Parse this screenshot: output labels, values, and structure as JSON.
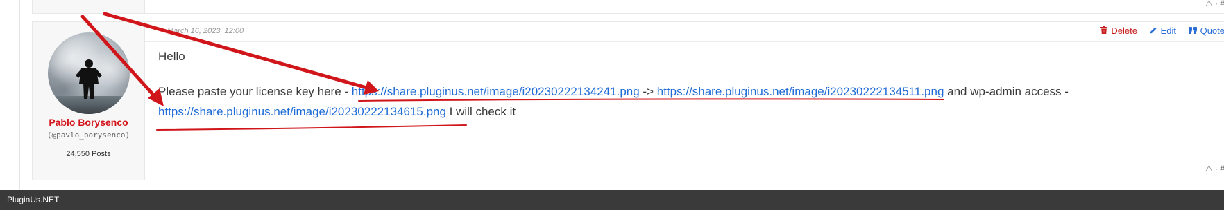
{
  "previous_post": {
    "footer_icons": "⚠ · #"
  },
  "post": {
    "author": {
      "name": "Pablo Borysenco",
      "handle": "(@pavlo_borysenco)",
      "posts": "24,550 Posts",
      "avatar_icon": "user-photo-avatar"
    },
    "date": "March 16, 2023, 12:00",
    "actions": {
      "delete_label": "Delete",
      "edit_label": "Edit",
      "quote_label": "Quote",
      "delete_icon": "trash-icon",
      "edit_icon": "pencil-icon",
      "quote_icon": "quote-icon"
    },
    "body": {
      "greeting": "Hello",
      "text_before_links": "Please paste your license key here - ",
      "link1": "https://share.pluginus.net/image/i20230222134241.png",
      "arrow_text": " -> ",
      "link2": "https://share.pluginus.net/image/i20230222134511.png",
      "text_middle": " and  wp-admin access - ",
      "link3": "https://share.pluginus.net/image/i20230222134615.png",
      "text_end": " I  will check it"
    },
    "footer_icons": "⚠ · #"
  },
  "colors": {
    "author_name": "#d3141a",
    "link": "#1f6cd6",
    "delete": "#c81e1e",
    "annotation": "#d0161b",
    "bottom_bar": "#3a3a3a"
  },
  "footer": {
    "brand": "PluginUs.NET"
  }
}
